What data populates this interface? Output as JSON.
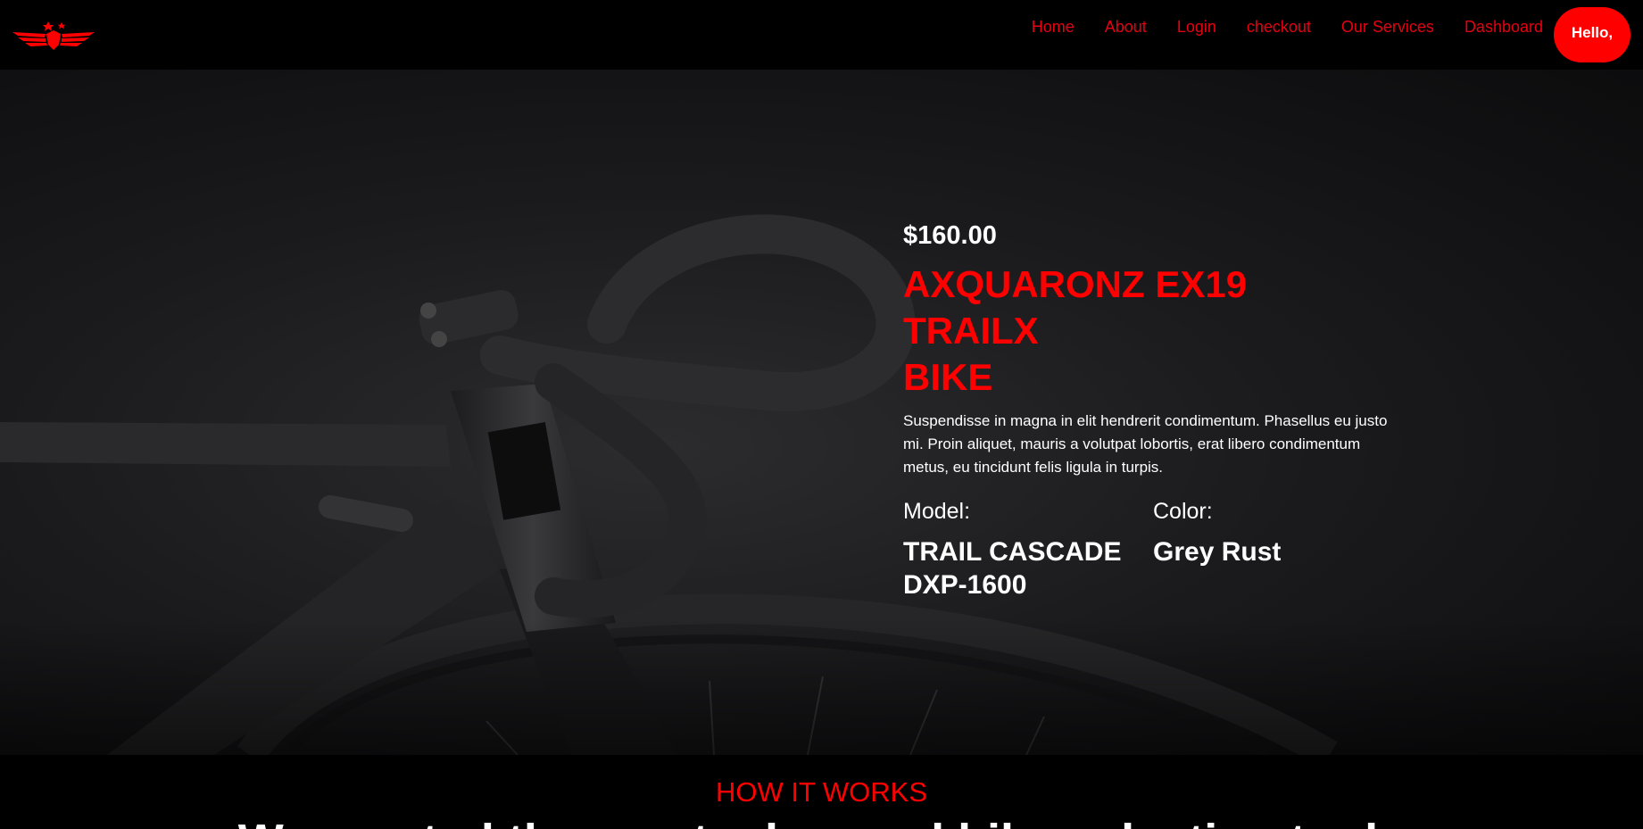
{
  "nav": {
    "links": [
      {
        "label": "Home"
      },
      {
        "label": "About"
      },
      {
        "label": "Login"
      },
      {
        "label": "checkout"
      },
      {
        "label": "Our Services"
      },
      {
        "label": "Dashboard"
      }
    ],
    "hello_button": "Hello,"
  },
  "product": {
    "price": "$160.00",
    "title_lines": [
      "AXQUARONZ EX19",
      "TRAILX",
      "BIKE"
    ],
    "description": "Suspendisse in magna in elit hendrerit condimentum. Phasellus eu justo mi. Proin aliquet, mauris a volutpat lobortis, erat libero condimentum metus, eu tincidunt felis ligula in turpis.",
    "model_label": "Model:",
    "model_value_lines": [
      "TRAIL CASCADE",
      "DXP-1600"
    ],
    "color_label": "Color:",
    "color_value": "Grey Rust"
  },
  "how_it_works": {
    "label": "HOW IT WORKS",
    "heading": "We created the most advanced bike selection tools"
  },
  "colors": {
    "accent": "#ff0000",
    "nav_link": "#e60012",
    "background": "#000000"
  }
}
